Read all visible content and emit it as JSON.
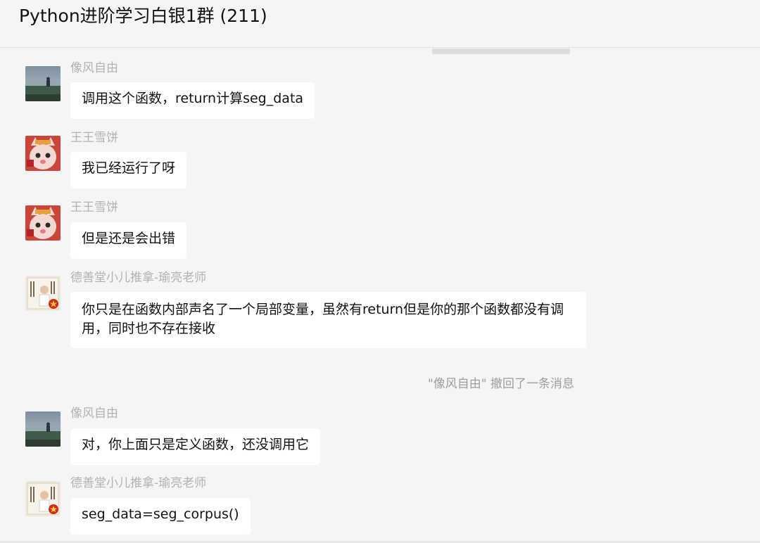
{
  "chat": {
    "title": "Python进阶学习白银1群 (211)"
  },
  "messages": [
    {
      "sender": "像风自由",
      "text": "调用这个函数，return计算seg_data",
      "avatar": "landscape-avatar"
    },
    {
      "sender": "王王雪饼",
      "text": "我已经运行了呀",
      "avatar": "cartoon-cat-avatar"
    },
    {
      "sender": "王王雪饼",
      "text": "但是还是会出错",
      "avatar": "cartoon-cat-avatar"
    },
    {
      "sender": "德善堂小儿推拿-瑜亮老师",
      "text": "你只是在函数内部声名了一个局部变量，虽然有return但是你的那个函数都没有调用，同时也不存在接收",
      "avatar": "teacher-avatar"
    },
    {
      "sender": "像风自由",
      "text": "对，你上面只是定义函数，还没调用它",
      "avatar": "landscape-avatar"
    },
    {
      "sender": "德善堂小儿推拿-瑜亮老师",
      "text": "seg_data=seg_corpus()",
      "avatar": "teacher-avatar"
    }
  ],
  "system_notice": "\"像风自由\" 撤回了一条消息",
  "colors": {
    "background": "#f5f5f5",
    "bubble": "#ffffff",
    "sender": "#b2b2b2"
  }
}
